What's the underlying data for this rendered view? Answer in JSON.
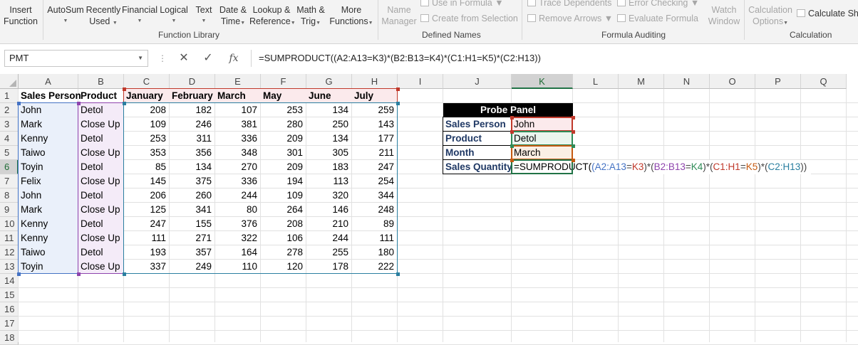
{
  "ribbon": {
    "insert_function": [
      "Insert",
      "Function"
    ],
    "autosum": "AutoSum",
    "recently_used": [
      "Recently",
      "Used"
    ],
    "financial": "Financial",
    "logical": "Logical",
    "text": "Text",
    "date_time": [
      "Date &",
      "Time"
    ],
    "lookup_reference": [
      "Lookup &",
      "Reference"
    ],
    "math_trig": [
      "Math &",
      "Trig"
    ],
    "more_functions": [
      "More",
      "Functions"
    ],
    "function_library_label": "Function Library",
    "name_manager": [
      "Name",
      "Manager"
    ],
    "use_in_formula": "Use in Formula",
    "create_from_selection": "Create from Selection",
    "defined_names_label": "Defined Names",
    "trace_dependents": "Trace Dependents",
    "remove_arrows": "Remove Arrows",
    "error_checking": "Error Checking",
    "evaluate_formula": "Evaluate Formula",
    "watch_window": [
      "Watch",
      "Window"
    ],
    "formula_auditing_label": "Formula Auditing",
    "calculation_options": [
      "Calculation",
      "Options"
    ],
    "calculate_sheet": "Calculate Sh",
    "calculation_label": "Calculation"
  },
  "formula_bar": {
    "name_box": "PMT",
    "cancel": "✕",
    "enter": "✓",
    "fx": "fx",
    "formula": "=SUMPRODUCT((A2:A13=K3)*(B2:B13=K4)*(C1:H1=K5)*(C2:H13))"
  },
  "columns": [
    "A",
    "B",
    "C",
    "D",
    "E",
    "F",
    "G",
    "H",
    "I",
    "J",
    "K",
    "L",
    "M",
    "N",
    "O",
    "P",
    "Q"
  ],
  "active_column": "K",
  "rows": [
    "1",
    "2",
    "3",
    "4",
    "5",
    "6",
    "7",
    "8",
    "9",
    "10",
    "11",
    "12",
    "13",
    "14",
    "15",
    "16",
    "17",
    "18"
  ],
  "active_row": "6",
  "table": {
    "headers": [
      "Sales Person",
      "Product",
      "January",
      "February",
      "March",
      "May",
      "June",
      "July"
    ],
    "data": [
      [
        "John",
        "Detol",
        208,
        182,
        107,
        253,
        134,
        259
      ],
      [
        "Mark",
        "Close Up",
        109,
        246,
        381,
        280,
        250,
        143
      ],
      [
        "Kenny",
        "Detol",
        253,
        311,
        336,
        209,
        134,
        177
      ],
      [
        "Taiwo",
        "Close Up",
        353,
        356,
        348,
        301,
        305,
        211
      ],
      [
        "Toyin",
        "Detol",
        85,
        134,
        270,
        209,
        183,
        247
      ],
      [
        "Felix",
        "Close Up",
        145,
        375,
        336,
        194,
        113,
        254
      ],
      [
        "John",
        "Detol",
        206,
        260,
        244,
        109,
        320,
        344
      ],
      [
        "Mark",
        "Close Up",
        125,
        341,
        80,
        264,
        146,
        248
      ],
      [
        "Kenny",
        "Detol",
        247,
        155,
        376,
        208,
        210,
        89
      ],
      [
        "Kenny",
        "Close Up",
        111,
        271,
        322,
        106,
        244,
        111
      ],
      [
        "Taiwo",
        "Detol",
        193,
        357,
        164,
        278,
        255,
        180
      ],
      [
        "Toyin",
        "Close Up",
        337,
        249,
        110,
        120,
        178,
        222
      ]
    ]
  },
  "probe_panel": {
    "title": "Probe Panel",
    "labels": [
      "Sales Person",
      "Product",
      "Month",
      "Sales Quantity"
    ],
    "values": [
      "John",
      "Detol",
      "March"
    ],
    "formula_parts": [
      "=SUMPRODUCT(",
      "(",
      "A2:A13",
      "=",
      "K3",
      ")*(",
      "B2:B13",
      "=",
      "K4",
      ")*(",
      "C1:H1",
      "=",
      "K5",
      ")*(",
      "C2:H13",
      "))"
    ]
  },
  "colors": {
    "range_a": "#4472c4",
    "range_b": "#8e44ad",
    "range_c1h1": "#c0392b",
    "range_data": "#2a7fa0",
    "k3": "#c0392b",
    "k4": "#2e8b57",
    "k5": "#c55a11",
    "selection": "#217346"
  }
}
